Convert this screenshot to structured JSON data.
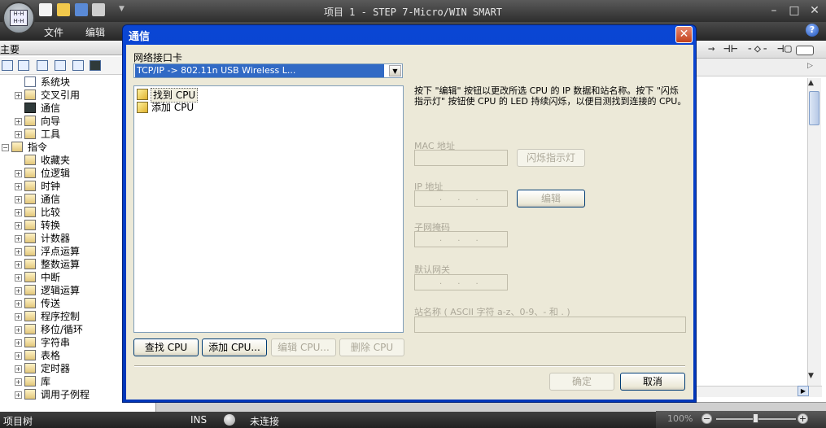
{
  "window": {
    "title": "项目 1 - STEP 7-Micro/WIN SMART"
  },
  "menu": [
    "文件",
    "编辑"
  ],
  "left_panel": {
    "title": "主要",
    "tree": [
      {
        "label": "系统块",
        "level": 1,
        "expand": ""
      },
      {
        "label": "交叉引用",
        "level": 1,
        "expand": "+"
      },
      {
        "label": "通信",
        "level": 1,
        "expand": ""
      },
      {
        "label": "向导",
        "level": 1,
        "expand": "+"
      },
      {
        "label": "工具",
        "level": 1,
        "expand": "+"
      },
      {
        "label": "指令",
        "level": 0,
        "expand": "−"
      },
      {
        "label": "收藏夹",
        "level": 1,
        "expand": ""
      },
      {
        "label": "位逻辑",
        "level": 1,
        "expand": "+"
      },
      {
        "label": "时钟",
        "level": 1,
        "expand": "+"
      },
      {
        "label": "通信",
        "level": 1,
        "expand": "+"
      },
      {
        "label": "比较",
        "level": 1,
        "expand": "+"
      },
      {
        "label": "转换",
        "level": 1,
        "expand": "+"
      },
      {
        "label": "计数器",
        "level": 1,
        "expand": "+"
      },
      {
        "label": "浮点运算",
        "level": 1,
        "expand": "+"
      },
      {
        "label": "整数运算",
        "level": 1,
        "expand": "+"
      },
      {
        "label": "中断",
        "level": 1,
        "expand": "+"
      },
      {
        "label": "逻辑运算",
        "level": 1,
        "expand": "+"
      },
      {
        "label": "传送",
        "level": 1,
        "expand": "+"
      },
      {
        "label": "程序控制",
        "level": 1,
        "expand": "+"
      },
      {
        "label": "移位/循环",
        "level": 1,
        "expand": "+"
      },
      {
        "label": "字符串",
        "level": 1,
        "expand": "+"
      },
      {
        "label": "表格",
        "level": 1,
        "expand": "+"
      },
      {
        "label": "定时器",
        "level": 1,
        "expand": "+"
      },
      {
        "label": "库",
        "level": 1,
        "expand": "+"
      },
      {
        "label": "调用子例程",
        "level": 1,
        "expand": "+"
      }
    ]
  },
  "dialog": {
    "title": "通信",
    "close": "✕",
    "nic_label": "网络接口卡",
    "nic_value": "TCP/IP -> 802.11n USB Wireless L...",
    "cpu_list": [
      "找到 CPU",
      "添加 CPU"
    ],
    "info": "按下 \"编辑\" 按钮以更改所选 CPU 的 IP 数据和站名称。按下 \"闪烁指示灯\" 按钮使 CPU 的 LED 持续闪烁，以便目测找到连接的 CPU。",
    "mac_label": "MAC 地址",
    "ip_label": "IP 地址",
    "subnet_label": "子网掩码",
    "gateway_label": "默认网关",
    "station_label": "站名称 ( ASCII 字符 a-z、0-9、- 和 . )",
    "ip_dots": ".      .      .",
    "buttons": {
      "blink": "闪烁指示灯",
      "edit": "编辑",
      "find": "查找 CPU",
      "add": "添加 CPU...",
      "edit_cpu": "编辑 CPU...",
      "delete_cpu": "删除 CPU",
      "ok": "确定",
      "cancel": "取消"
    }
  },
  "status": {
    "left": "项目树",
    "ins": "INS",
    "conn": "未连接",
    "zoom": "100%"
  },
  "icons": {
    "help": "?",
    "minimize": "–",
    "maximize": "□",
    "close": "✕"
  }
}
